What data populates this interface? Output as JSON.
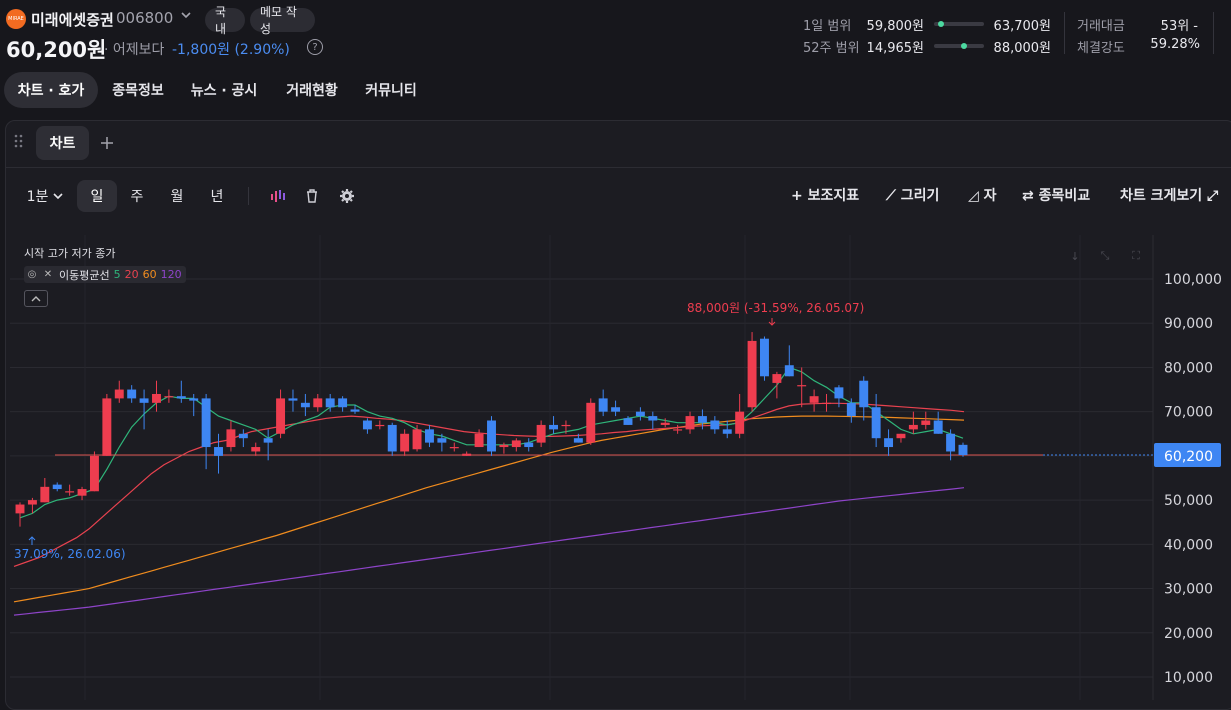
{
  "header": {
    "logo_text": "MIRAE",
    "stock_name": "미래에셋증권",
    "stock_code": "006800",
    "market_pill": "국내",
    "memo_pill": "메모 작성",
    "price": "60,200원",
    "diff_label": "· 어제보다",
    "diff_value": "-1,800원 (2.90%)",
    "help": "?"
  },
  "ranges": {
    "day_label": "1일 범위",
    "day_low": "59,800원",
    "day_high": "63,700원",
    "day_position": 0.1,
    "w52_label": "52주 범위",
    "w52_low": "14,965원",
    "w52_high": "88,000원",
    "w52_position": 0.62,
    "trade_value_label": "거래대금",
    "trade_value": "53위 -",
    "strength_label": "체결강도",
    "strength": "59.28%"
  },
  "tabs": [
    "차트 · 호가",
    "종목정보",
    "뉴스 · 공시",
    "거래현황",
    "커뮤니티"
  ],
  "chart_panel": {
    "tab_label": "차트",
    "interval": "1분",
    "periods": [
      "일",
      "주",
      "월",
      "년"
    ],
    "active_period": "일",
    "tools": {
      "indicator": "+ 보조지표",
      "draw": "그리기",
      "ruler": "자",
      "compare": "종목비교",
      "enlarge": "차트 크게보기"
    },
    "legend_title": "시작 고가 저가 종가",
    "ma_label": "이동평균선",
    "ma_periods": [
      "5",
      "20",
      "60",
      "120"
    ],
    "ma_colors": [
      "#2fb57a",
      "#e8424f",
      "#f08c1e",
      "#8e44c9"
    ]
  },
  "chart_data": {
    "type": "candlestick",
    "ylim": [
      0,
      110000
    ],
    "yticks": [
      "100,000",
      "90,000",
      "80,000",
      "70,000",
      "60,000",
      "50,000",
      "40,000",
      "30,000",
      "20,000",
      "10,000"
    ],
    "ytick_values": [
      100000,
      90000,
      80000,
      70000,
      60000,
      50000,
      40000,
      30000,
      20000,
      10000
    ],
    "current_price": 60200,
    "current_price_label": "60,200",
    "up_color": "#ee3d4f",
    "down_color": "#3e86f3",
    "high_annotation": "88,000원 (-31.59%, 26.05.07)",
    "low_annotation": "37.09%, 26.02.06)",
    "candles": [
      [
        47000,
        49500,
        44000,
        49000
      ],
      [
        49000,
        50500,
        47000,
        50000
      ],
      [
        49500,
        55000,
        49500,
        53000
      ],
      [
        53500,
        54000,
        52000,
        52500
      ],
      [
        52000,
        53500,
        51000,
        52000
      ],
      [
        51000,
        53000,
        50000,
        52500
      ],
      [
        52000,
        61000,
        52000,
        60000
      ],
      [
        60000,
        74000,
        60000,
        73000
      ],
      [
        73000,
        77000,
        72000,
        75000
      ],
      [
        75000,
        76000,
        72000,
        73000
      ],
      [
        73000,
        75000,
        66000,
        72000
      ],
      [
        72000,
        77000,
        70000,
        74000
      ],
      [
        73500,
        75000,
        72000,
        73500
      ],
      [
        73500,
        77000,
        72000,
        73000
      ],
      [
        73000,
        74000,
        69000,
        72500
      ],
      [
        73000,
        74000,
        57000,
        62000
      ],
      [
        62000,
        65000,
        56000,
        60000
      ],
      [
        62000,
        68000,
        61000,
        66000
      ],
      [
        65000,
        66000,
        62000,
        64000
      ],
      [
        61000,
        63000,
        60000,
        62000
      ],
      [
        64000,
        66000,
        59000,
        63000
      ],
      [
        65000,
        75000,
        64000,
        73000
      ],
      [
        73000,
        75000,
        70000,
        72500
      ],
      [
        72000,
        74000,
        69000,
        71000
      ],
      [
        71000,
        74000,
        70000,
        73000
      ],
      [
        73000,
        74000,
        70000,
        71000
      ],
      [
        73000,
        73500,
        70000,
        71000
      ],
      [
        70500,
        71500,
        69500,
        70000
      ],
      [
        68000,
        68500,
        65000,
        66000
      ],
      [
        67000,
        68000,
        66000,
        67000
      ],
      [
        67000,
        67500,
        60000,
        61000
      ],
      [
        61000,
        66000,
        60000,
        65000
      ],
      [
        61500,
        67000,
        61000,
        66000
      ],
      [
        66000,
        67000,
        62000,
        63000
      ],
      [
        64000,
        65000,
        61000,
        63000
      ],
      [
        62000,
        63000,
        61000,
        62000
      ],
      [
        60000,
        61000,
        60000,
        60500
      ],
      [
        62000,
        66000,
        62000,
        65000
      ],
      [
        68000,
        69000,
        60000,
        61000
      ],
      [
        62000,
        63000,
        60500,
        62500
      ],
      [
        62000,
        64000,
        61000,
        63500
      ],
      [
        63000,
        64000,
        61000,
        62000
      ],
      [
        63000,
        68000,
        62000,
        67000
      ],
      [
        67000,
        69000,
        65000,
        66000
      ],
      [
        67000,
        68000,
        65000,
        67000
      ],
      [
        64000,
        65000,
        63000,
        63000
      ],
      [
        63000,
        73000,
        62500,
        72000
      ],
      [
        73000,
        75000,
        69000,
        70000
      ],
      [
        71000,
        72500,
        69000,
        70000
      ],
      [
        68500,
        69000,
        67000,
        67000
      ],
      [
        70000,
        71000,
        68000,
        69000
      ],
      [
        69000,
        70000,
        66000,
        68000
      ],
      [
        67000,
        68500,
        66500,
        67500
      ],
      [
        66000,
        67000,
        65000,
        66000
      ],
      [
        66000,
        70000,
        65000,
        69000
      ],
      [
        69000,
        70500,
        66000,
        67500
      ],
      [
        68000,
        69000,
        65000,
        66000
      ],
      [
        66000,
        68000,
        64000,
        65000
      ],
      [
        65000,
        74000,
        64000,
        70000
      ],
      [
        71000,
        88000,
        70000,
        86000
      ],
      [
        86500,
        87000,
        77000,
        78000
      ],
      [
        76500,
        79000,
        73000,
        78500
      ],
      [
        80500,
        85000,
        78000,
        78000
      ],
      [
        76000,
        80000,
        71000,
        76000
      ],
      [
        72000,
        75000,
        70000,
        73500
      ],
      [
        72000,
        74000,
        70000,
        72000
      ],
      [
        75500,
        76000,
        71000,
        73000
      ],
      [
        72000,
        73000,
        67500,
        69000
      ],
      [
        77000,
        78000,
        68000,
        71000
      ],
      [
        71000,
        74000,
        62000,
        64000
      ],
      [
        64000,
        66000,
        60000,
        62000
      ],
      [
        64000,
        65000,
        63000,
        65000
      ],
      [
        66000,
        70000,
        65000,
        67000
      ],
      [
        67000,
        70000,
        66000,
        68000
      ],
      [
        68000,
        70000,
        65000,
        65000
      ],
      [
        65000,
        66000,
        59000,
        61000
      ],
      [
        62500,
        63000,
        59800,
        60200
      ]
    ],
    "ma5": [
      46000,
      47000,
      49000,
      50000,
      50500,
      51500,
      52500,
      57000,
      62000,
      66500,
      69500,
      72000,
      73500,
      73000,
      73000,
      71000,
      69000,
      68000,
      67000,
      66000,
      64000,
      65500,
      67000,
      68000,
      69000,
      71000,
      71500,
      71500,
      70000,
      69000,
      68500,
      67500,
      66000,
      65000,
      64500,
      63500,
      62500,
      62500,
      62500,
      62500,
      62500,
      63000,
      64000,
      65000,
      65500,
      66000,
      67000,
      67500,
      68000,
      68500,
      69000,
      68500,
      68000,
      67500,
      67500,
      67500,
      67500,
      67000,
      67500,
      70000,
      73000,
      76000,
      80000,
      79000,
      77000,
      75500,
      73500,
      72000,
      72000,
      70000,
      68000,
      66000,
      65000,
      65500,
      66000,
      65000,
      64000
    ],
    "ma20": [
      35000,
      36000,
      37000,
      38500,
      40000,
      41500,
      43500,
      46000,
      48500,
      51000,
      53500,
      56000,
      58000,
      59500,
      61000,
      62000,
      63000,
      63500,
      64500,
      65500,
      66000,
      66500,
      67000,
      67500,
      68000,
      68500,
      68800,
      69000,
      68800,
      68500,
      68300,
      68000,
      67500,
      67000,
      66500,
      66000,
      65500,
      65200,
      65000,
      64800,
      64600,
      64500,
      64400,
      64400,
      64500,
      64600,
      64800,
      65000,
      65300,
      65500,
      65800,
      66000,
      66200,
      66400,
      66600,
      66800,
      66900,
      67000,
      67500,
      68500,
      69500,
      70500,
      71300,
      71700,
      71800,
      71900,
      71900,
      71800,
      71700,
      71500,
      71300,
      71100,
      70900,
      70700,
      70500,
      70300,
      70000
    ],
    "ma60": [
      27000,
      27500,
      28000,
      28500,
      29000,
      29500,
      30000,
      30800,
      31600,
      32400,
      33200,
      34000,
      34800,
      35600,
      36400,
      37200,
      38000,
      38800,
      39600,
      40400,
      41200,
      42000,
      42900,
      43800,
      44700,
      45600,
      46500,
      47400,
      48300,
      49200,
      50100,
      51000,
      51900,
      52800,
      53600,
      54400,
      55200,
      56000,
      56800,
      57600,
      58400,
      59200,
      60000,
      60800,
      61500,
      62200,
      62900,
      63500,
      64000,
      64500,
      65000,
      65500,
      66000,
      66400,
      66800,
      67200,
      67500,
      67800,
      68100,
      68400,
      68600,
      68800,
      68900,
      69000,
      69000,
      69000,
      68950,
      68900,
      68850,
      68800,
      68700,
      68600,
      68500,
      68400,
      68300,
      68200,
      68100
    ],
    "ma120": [
      24000,
      24300,
      24600,
      24900,
      25200,
      25500,
      25800,
      26200,
      26600,
      27000,
      27400,
      27800,
      28200,
      28600,
      29000,
      29400,
      29800,
      30200,
      30600,
      31000,
      31400,
      31800,
      32200,
      32600,
      33000,
      33400,
      33800,
      34200,
      34600,
      35000,
      35400,
      35800,
      36200,
      36600,
      37000,
      37400,
      37800,
      38200,
      38600,
      39000,
      39400,
      39800,
      40200,
      40600,
      41000,
      41400,
      41800,
      42200,
      42600,
      43000,
      43400,
      43800,
      44200,
      44600,
      45000,
      45400,
      45800,
      46200,
      46600,
      47000,
      47400,
      47800,
      48200,
      48600,
      49000,
      49400,
      49800,
      50100,
      50400,
      50700,
      51000,
      51300,
      51600,
      51900,
      52200,
      52500,
      52800
    ]
  }
}
